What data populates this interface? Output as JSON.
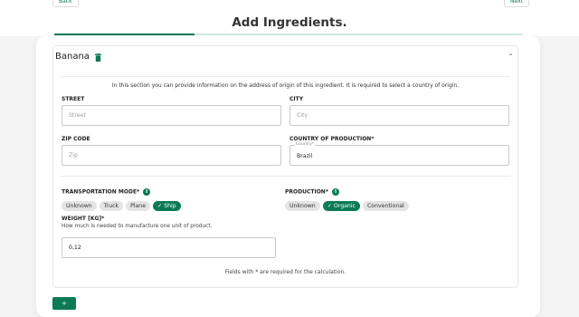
{
  "nav": {
    "back_label": "Back",
    "next_label": "Next"
  },
  "header": {
    "title": "Add Ingredients.",
    "progress": 0.3
  },
  "ingredient": {
    "name": "Banana",
    "info_text": "In this section you can provide information on the address of origin of this ingredient. It is required to select a country of origin.",
    "street": {
      "label": "STREET",
      "placeholder": "Street"
    },
    "city": {
      "label": "CITY",
      "placeholder": "City"
    },
    "zip": {
      "label": "ZIP CODE",
      "placeholder": "Zip"
    },
    "country": {
      "label": "COUNTRY OF PRODUCTION*",
      "legend": "Country*",
      "value": "Brazil"
    },
    "transport": {
      "label": "TRANSPORTATION MODE*",
      "options": [
        "Unknown",
        "Truck",
        "Plane",
        "Ship"
      ],
      "selected": "Ship"
    },
    "production": {
      "label": "PRODUCTION*",
      "options": [
        "Unknown",
        "Organic",
        "Conventional"
      ],
      "selected": "Organic"
    },
    "weight": {
      "label": "WEIGHT [KG]*",
      "help": "How much is needed to manufacture one unit of product.",
      "value": "0,12"
    },
    "required_note": "Fields with * are required for the calculation."
  },
  "actions": {
    "add_label": "+"
  },
  "icons": {
    "trash": "trash-icon",
    "chevron": "chevron-up-icon",
    "info": "info-icon",
    "check": "check-icon"
  },
  "colors": {
    "accent": "#0b7a55"
  }
}
